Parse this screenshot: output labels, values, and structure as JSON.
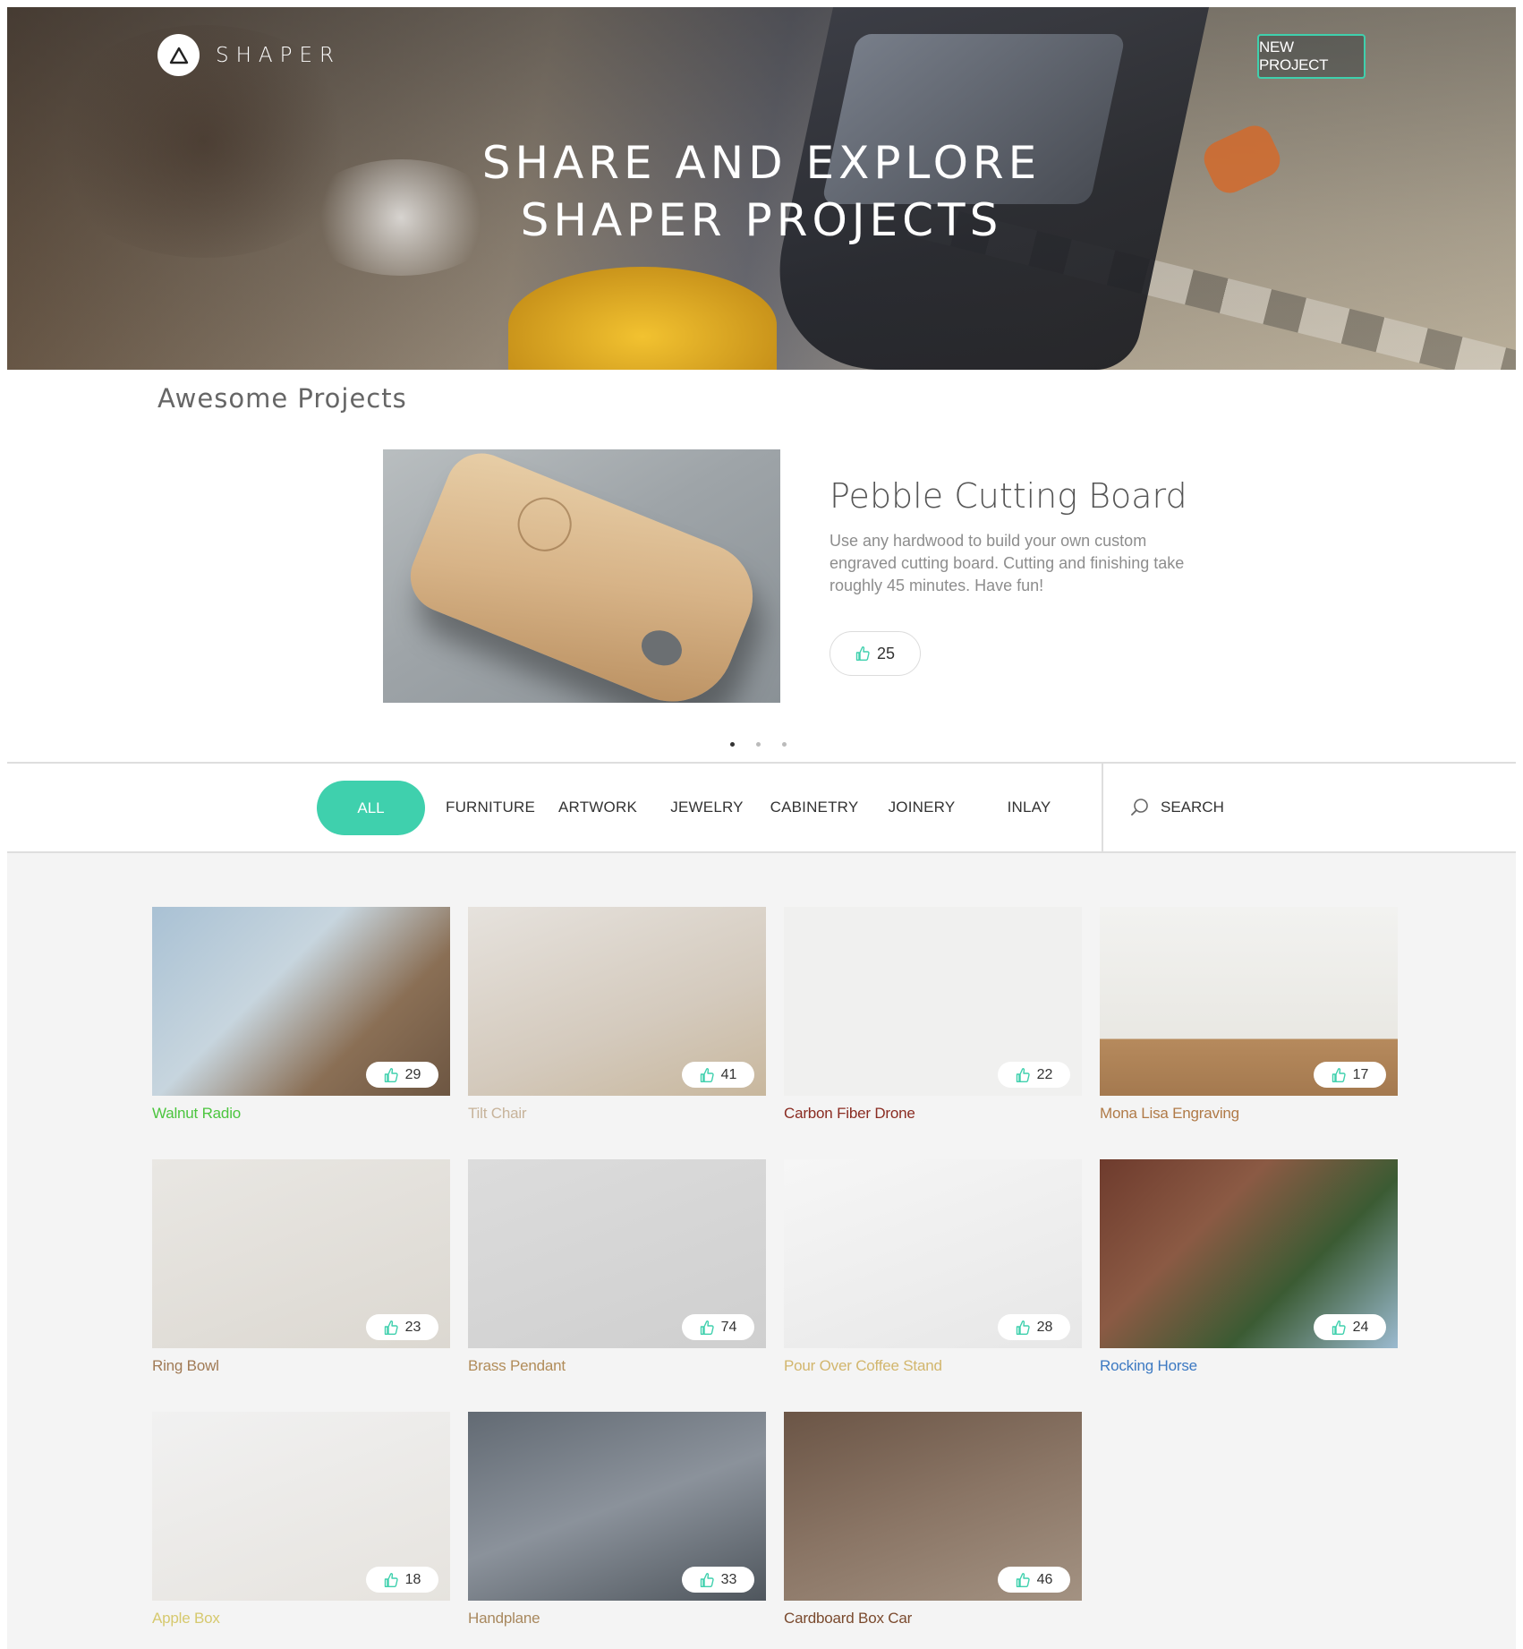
{
  "brand": {
    "name": "SHAPER"
  },
  "header": {
    "new_project_label": "NEW PROJECT",
    "title_line1": "SHARE AND EXPLORE",
    "title_line2": "SHAPER PROJECTS"
  },
  "featured": {
    "section_title": "Awesome Projects",
    "title": "Pebble Cutting Board",
    "description": "Use any hardwood to build your own custom engraved cutting board. Cutting and finishing take roughly 45 minutes. Have fun!",
    "likes": "25",
    "carousel": {
      "pages": 3,
      "active": 1
    }
  },
  "filters": {
    "items": [
      "ALL",
      "FURNITURE",
      "ARTWORK",
      "JEWELRY",
      "CABINETRY",
      "JOINERY",
      "INLAY"
    ],
    "active": "ALL",
    "search_label": "SEARCH"
  },
  "colors": {
    "accent": "#3fd0ad",
    "background_grid": "#f4f4f4"
  },
  "projects": [
    {
      "title": "Walnut Radio",
      "likes": "29",
      "title_color": "#4cc53f"
    },
    {
      "title": "Tilt Chair",
      "likes": "41",
      "title_color": "#c7b39a"
    },
    {
      "title": "Carbon Fiber Drone",
      "likes": "22",
      "title_color": "#8a2c22"
    },
    {
      "title": "Mona Lisa Engraving",
      "likes": "17",
      "title_color": "#b07a47"
    },
    {
      "title": "Ring Bowl",
      "likes": "23",
      "title_color": "#a07a55"
    },
    {
      "title": "Brass Pendant",
      "likes": "74",
      "title_color": "#b18c59"
    },
    {
      "title": "Pour Over Coffee Stand",
      "likes": "28",
      "title_color": "#d2b66d"
    },
    {
      "title": "Rocking Horse",
      "likes": "24",
      "title_color": "#3c79c2"
    },
    {
      "title": "Apple Box",
      "likes": "18",
      "title_color": "#d6c96e"
    },
    {
      "title": "Handplane",
      "likes": "33",
      "title_color": "#a8885e"
    },
    {
      "title": "Cardboard Box Car",
      "likes": "46",
      "title_color": "#7a4a2e"
    }
  ]
}
